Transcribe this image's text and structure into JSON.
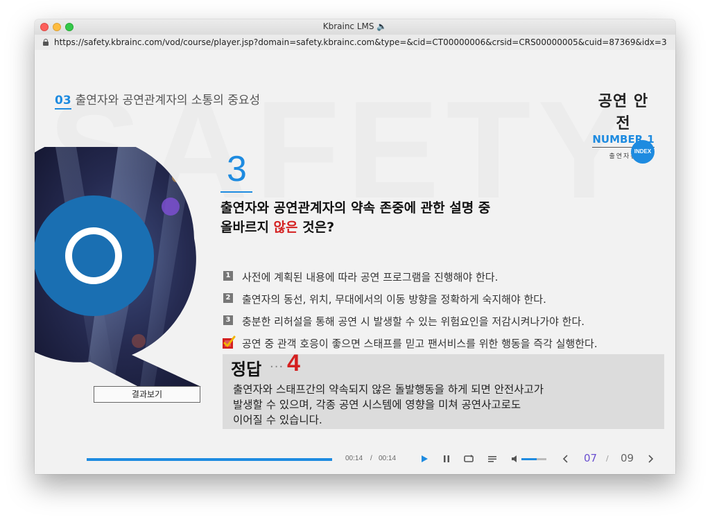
{
  "window": {
    "title": "Kbrainc LMS 🔈",
    "url": "https://safety.kbrainc.com/vod/course/player.jsp?domain=safety.kbrainc.com&type=&cid=CT00000006&crsid=CRS00000005&cuid=87369&idx=3"
  },
  "header": {
    "section_number": "03",
    "section_title": "출연자와 공연관계자의 소통의 중요성",
    "brand_title": "공연 안전",
    "brand_subtitle": "NUMBER.1",
    "brand_part": "출연자편",
    "index_label": "INDEX"
  },
  "watermark": "SAFETY",
  "question": {
    "number": "3",
    "line1": "출연자와 공연관계자의 약속 존중에 관한 설명 중",
    "line2_pre": "올바르지 ",
    "line2_highlight": "않은",
    "line2_post": " 것은?"
  },
  "options": [
    {
      "num": "1",
      "text": "사전에 계획된 내용에 따라 공연 프로그램을 진행해야 한다.",
      "selected": false
    },
    {
      "num": "2",
      "text": "출연자의 동선, 위치, 무대에서의 이동 방향을 정확하게 숙지해야 한다.",
      "selected": false
    },
    {
      "num": "3",
      "text": "충분한 리허설을 통해 공연 시 발생할 수 있는 위험요인을 저감시켜나가야 한다.",
      "selected": false
    },
    {
      "num": "4",
      "text": "공연 중 관객 호응이 좋으면 스태프를 믿고 팬서비스를 위한 행동을 즉각 실행한다.",
      "selected": true
    }
  ],
  "answer": {
    "label": "정답",
    "dots": "···",
    "number": "4",
    "explanation_line1": "출연자와 스태프간의 약속되지 않은 돌발행동을 하게 되면 안전사고가",
    "explanation_line2": "발생할 수 있으며, 각종 공연 시스템에 영향을 미쳐 공연사고로도",
    "explanation_line3": "이어질 수 있습니다."
  },
  "result_button": "결과보기",
  "player": {
    "current_time": "00:14",
    "time_sep": "/",
    "total_time": "00:14",
    "progress": 1.0,
    "volume": 0.6,
    "page_current": "07",
    "page_sep": "/",
    "page_total": "09"
  },
  "colors": {
    "accent": "#1e8be0",
    "highlight": "#d42020",
    "page_current": "#6a4fd0"
  },
  "icons": [
    "lock-icon",
    "q-logo-icon",
    "check-icon",
    "play-icon",
    "pause-icon",
    "repeat-icon",
    "list-icon",
    "speaker-icon",
    "prev-icon",
    "next-icon"
  ]
}
